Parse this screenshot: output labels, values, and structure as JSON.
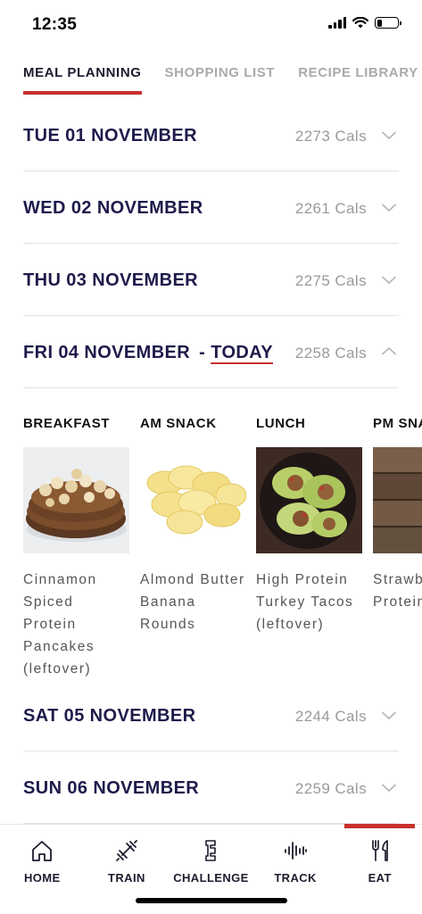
{
  "status_bar": {
    "time": "12:35",
    "battery_level": 0.25
  },
  "tabs": [
    {
      "label": "MEAL PLANNING",
      "active": true
    },
    {
      "label": "SHOPPING LIST",
      "active": false
    },
    {
      "label": "RECIPE LIBRARY",
      "active": false
    }
  ],
  "days": [
    {
      "label": "TUE 01 NOVEMBER",
      "cals": "2273 Cals",
      "expanded": false
    },
    {
      "label": "WED 02 NOVEMBER",
      "cals": "2261 Cals",
      "expanded": false
    },
    {
      "label": "THU 03 NOVEMBER",
      "cals": "2275 Cals",
      "expanded": false
    },
    {
      "label": "FRI 04 NOVEMBER",
      "today_sep": "-",
      "today_label": "TODAY",
      "cals": "2258 Cals",
      "expanded": true
    },
    {
      "label": "SAT 05 NOVEMBER",
      "cals": "2244 Cals",
      "expanded": false
    },
    {
      "label": "SUN 06 NOVEMBER",
      "cals": "2259 Cals",
      "expanded": false
    }
  ],
  "meals": [
    {
      "type": "BREAKFAST",
      "name": "Cinnamon Spiced Protein Pancakes (leftover)",
      "image": "pancakes-photo"
    },
    {
      "type": "AM SNACK",
      "name": "Almond Butter Banana Rounds",
      "image": "banana-slices-photo"
    },
    {
      "type": "LUNCH",
      "name": "High Protein Turkey Tacos (leftover)",
      "image": "lettuce-tacos-photo"
    },
    {
      "type": "PM SNACK",
      "name": "Strawberry Protein Shake",
      "image": "wood-table-photo"
    }
  ],
  "bottom_nav": [
    {
      "label": "HOME",
      "icon": "home-icon",
      "active": false
    },
    {
      "label": "TRAIN",
      "icon": "dumbbell-icon",
      "active": false
    },
    {
      "label": "CHALLENGE",
      "icon": "challenge-icon",
      "active": false
    },
    {
      "label": "TRACK",
      "icon": "waveform-icon",
      "active": false
    },
    {
      "label": "EAT",
      "icon": "fork-knife-icon",
      "active": true
    }
  ],
  "colors": {
    "accent": "#c8302e",
    "heading": "#1e1b4b",
    "muted": "#9a9a9a"
  }
}
